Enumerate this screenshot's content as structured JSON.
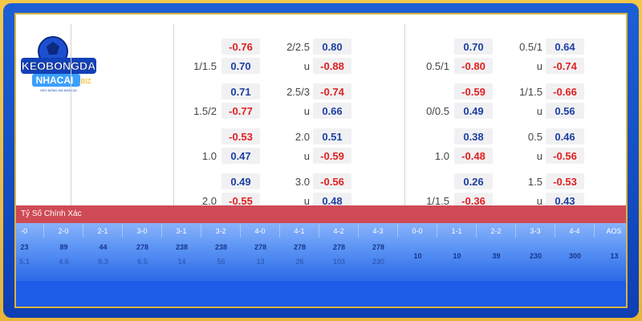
{
  "logo": {
    "line1": "KEOBONGDA",
    "line2": "NHACAI",
    "tld": ".BIZ",
    "tagline": "KÈO BÓNG ĐÁ NHÀ CÁI"
  },
  "odds_col1": [
    {
      "top_val": "-0.76",
      "top_label": "2/2.5",
      "top_val2": "0.80",
      "bot_label": "1/1.5",
      "bot_val": "0.70",
      "bot_label2": "u",
      "bot_val2": "-0.88"
    },
    {
      "top_val": "0.71",
      "top_label": "2.5/3",
      "top_val2": "-0.74",
      "bot_label": "1.5/2",
      "bot_val": "-0.77",
      "bot_label2": "u",
      "bot_val2": "0.66"
    },
    {
      "top_val": "-0.53",
      "top_label": "2.0",
      "top_val2": "0.51",
      "bot_label": "1.0",
      "bot_val": "0.47",
      "bot_label2": "u",
      "bot_val2": "-0.59"
    },
    {
      "top_val": "0.49",
      "top_label": "3.0",
      "top_val2": "-0.56",
      "bot_label": "2.0",
      "bot_val": "-0.55",
      "bot_label2": "u",
      "bot_val2": "0.48"
    }
  ],
  "odds_col2": [
    {
      "top_val": "0.70",
      "top_label": "0.5/1",
      "top_val2": "0.64",
      "bot_label": "0.5/1",
      "bot_val": "-0.80",
      "bot_label2": "u",
      "bot_val2": "-0.74"
    },
    {
      "top_val": "-0.59",
      "top_label": "1/1.5",
      "top_val2": "-0.66",
      "bot_label": "0/0.5",
      "bot_val": "0.49",
      "bot_label2": "u",
      "bot_val2": "0.56"
    },
    {
      "top_val": "0.38",
      "top_label": "0.5",
      "top_val2": "0.46",
      "bot_label": "1.0",
      "bot_val": "-0.48",
      "bot_label2": "u",
      "bot_val2": "-0.56"
    },
    {
      "top_val": "0.26",
      "top_label": "1.5",
      "top_val2": "-0.53",
      "bot_label": "1/1.5",
      "bot_val": "-0.36",
      "bot_label2": "u",
      "bot_val2": "0.43"
    }
  ],
  "correct_score": {
    "title": "Tỷ Số Chính Xác",
    "headers": [
      "-0",
      "2-0",
      "2-1",
      "3-0",
      "3-1",
      "3-2",
      "4-0",
      "4-1",
      "4-2",
      "4-3",
      "0-0",
      "1-1",
      "2-2",
      "3-3",
      "4-4",
      "AOS"
    ],
    "row1": [
      "23",
      "89",
      "44",
      "278",
      "238",
      "238",
      "278",
      "278",
      "278",
      "278"
    ],
    "row2": [
      "5.1",
      "4.6",
      "9.3",
      "6.5",
      "14",
      "56",
      "13",
      "26",
      "103",
      "230"
    ],
    "draw_values": [
      "10",
      "10",
      "39",
      "230",
      "300",
      "13"
    ]
  },
  "colors": {
    "negative": "#e02020",
    "positive": "#1d3fa0",
    "title_bar": "#cf4a55",
    "frame_blue": "#1d5fd6",
    "frame_gold": "#f3c84a"
  }
}
